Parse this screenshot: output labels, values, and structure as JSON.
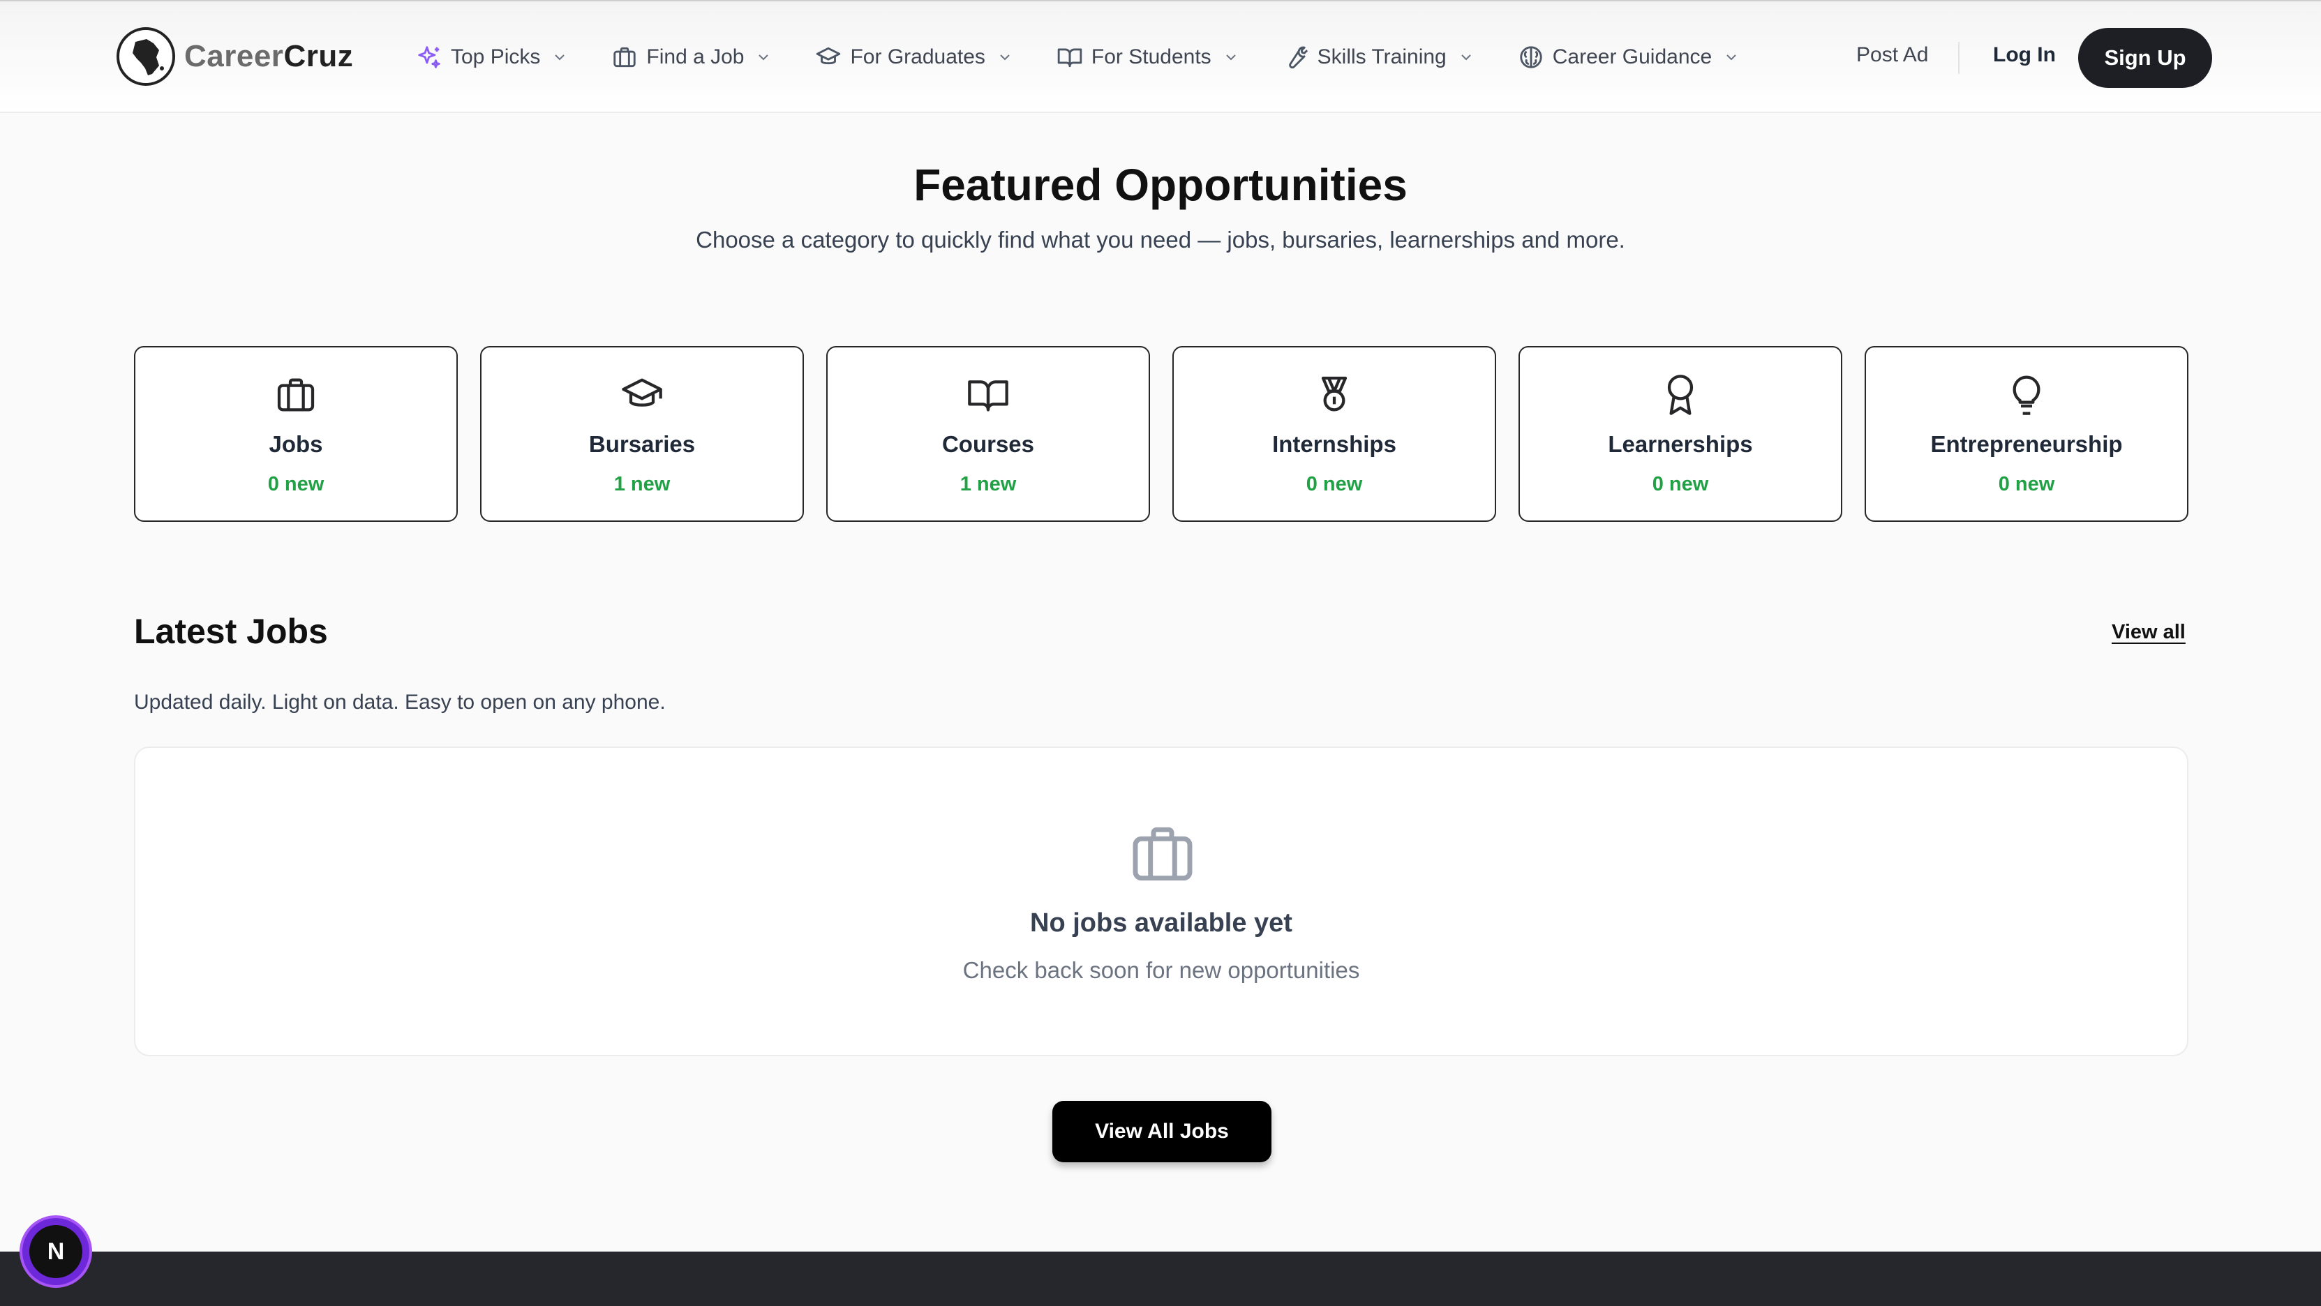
{
  "brand": {
    "name_part1": "Career",
    "name_part2": "Cruz"
  },
  "nav": {
    "items": [
      {
        "label": "Top Picks",
        "icon": "sparkles-icon"
      },
      {
        "label": "Find a Job",
        "icon": "briefcase-icon"
      },
      {
        "label": "For Graduates",
        "icon": "graduation-cap-icon"
      },
      {
        "label": "For Students",
        "icon": "book-open-icon"
      },
      {
        "label": "Skills Training",
        "icon": "wrench-icon"
      },
      {
        "label": "Career Guidance",
        "icon": "brain-icon"
      }
    ],
    "post_ad": "Post Ad",
    "login": "Log In",
    "signup": "Sign Up"
  },
  "featured": {
    "title": "Featured Opportunities",
    "subtitle": "Choose a category to quickly find what you need — jobs, bursaries, learnerships and more.",
    "categories": [
      {
        "name": "Jobs",
        "new": "0 new",
        "icon": "briefcase-icon"
      },
      {
        "name": "Bursaries",
        "new": "1 new",
        "icon": "graduation-cap-icon"
      },
      {
        "name": "Courses",
        "new": "1 new",
        "icon": "book-open-icon"
      },
      {
        "name": "Internships",
        "new": "0 new",
        "icon": "medal-icon"
      },
      {
        "name": "Learnerships",
        "new": "0 new",
        "icon": "award-icon"
      },
      {
        "name": "Entrepreneurship",
        "new": "0 new",
        "icon": "lightbulb-icon"
      }
    ]
  },
  "latest": {
    "title": "Latest Jobs",
    "view_all": "View all",
    "subtitle": "Updated daily. Light on data. Easy to open on any phone.",
    "empty_title": "No jobs available yet",
    "empty_subtitle": "Check back soon for new opportunities",
    "view_all_jobs": "View All Jobs"
  },
  "dev_badge": {
    "letter": "N"
  },
  "colors": {
    "accent_purple": "#8b5cf6",
    "new_green": "#22a045",
    "dark": "#1d1f24"
  }
}
